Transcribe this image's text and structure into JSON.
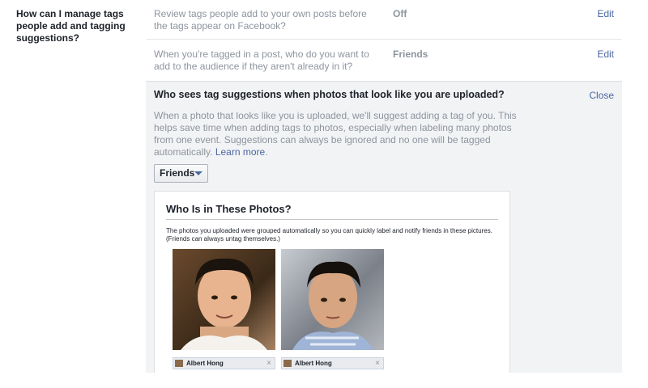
{
  "section": {
    "title": "How can I manage tags people add and tagging suggestions?"
  },
  "rows": [
    {
      "description": "Review tags people add to your own posts before the tags appear on Facebook?",
      "value": "Off",
      "action": "Edit"
    },
    {
      "description": "When you're tagged in a post, who do you want to add to the audience if they aren't already in it?",
      "value": "Friends",
      "action": "Edit"
    }
  ],
  "expanded": {
    "question": "Who sees tag suggestions when photos that look like you are uploaded?",
    "close_label": "Close",
    "explanation": "When a photo that looks like you is uploaded, we'll suggest adding a tag of you. This helps save time when adding tags to photos, especially when labeling many photos from one event. Suggestions can always be ignored and no one will be tagged automatically.",
    "learn_more": "Learn more",
    "dropdown_value": "Friends",
    "preview": {
      "title": "Who Is in These Photos?",
      "description": "The photos you uploaded were grouped automatically so you can quickly label and notify friends in these pictures. (Friends can always untag themselves.)",
      "photos": [
        {
          "tag_name": "Albert Hong",
          "icon": "person-photo"
        },
        {
          "tag_name": "Albert Hong",
          "icon": "person-photo"
        }
      ],
      "remove_glyph": "×"
    }
  },
  "colors": {
    "link": "#4b67a1",
    "muted": "#8d949e",
    "panel_bg": "#f2f3f5"
  }
}
